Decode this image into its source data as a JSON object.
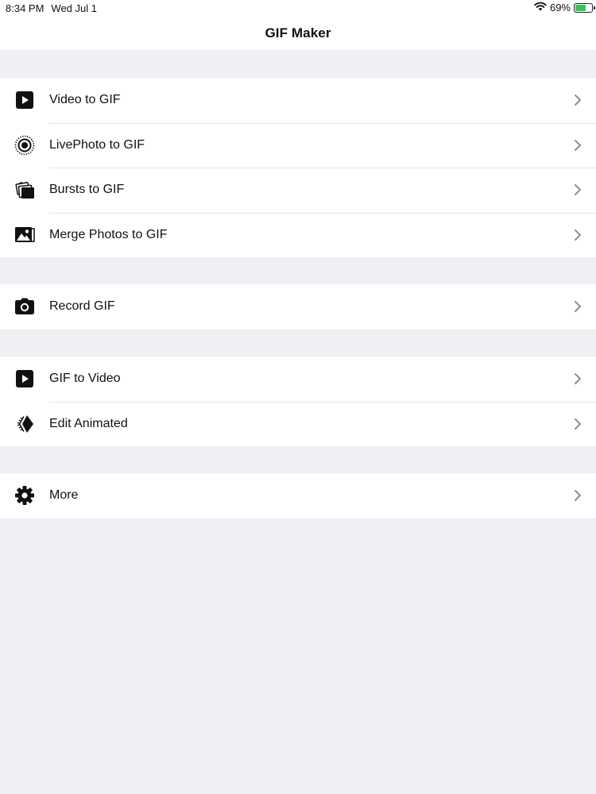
{
  "status_bar": {
    "time": "8:34 PM",
    "date": "Wed Jul 1",
    "battery_percent_text": "69%",
    "battery_level": 0.69,
    "battery_color": "#34c759"
  },
  "nav": {
    "title": "GIF Maker"
  },
  "sections": [
    {
      "rows": [
        {
          "label": "Video to GIF",
          "icon": "play-square-icon"
        },
        {
          "label": "LivePhoto to GIF",
          "icon": "live-photo-icon"
        },
        {
          "label": "Bursts to GIF",
          "icon": "bursts-icon"
        },
        {
          "label": "Merge Photos to GIF",
          "icon": "photos-icon"
        }
      ]
    },
    {
      "rows": [
        {
          "label": "Record GIF",
          "icon": "camera-icon"
        }
      ]
    },
    {
      "rows": [
        {
          "label": "GIF to Video",
          "icon": "play-square-icon"
        },
        {
          "label": "Edit Animated",
          "icon": "edit-animated-icon"
        }
      ]
    },
    {
      "rows": [
        {
          "label": "More",
          "icon": "gear-icon"
        }
      ]
    }
  ],
  "colors": {
    "background": "#efeff4",
    "cell": "#ffffff",
    "separator": "#e4e4e8",
    "chevron": "#8e8e93"
  }
}
